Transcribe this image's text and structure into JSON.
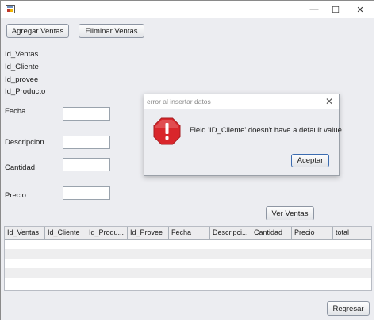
{
  "window": {
    "icons": {
      "app": "java-app-icon",
      "minimize": "minimize-icon",
      "maximize": "maximize-icon",
      "close": "close-icon"
    },
    "min_glyph": "—",
    "max_glyph": "☐",
    "close_glyph": "✕"
  },
  "toolbar": {
    "add_label": "Agregar Ventas",
    "delete_label": "Eliminar Ventas"
  },
  "info_labels": [
    "Id_Ventas",
    "Id_Cliente",
    "Id_provee",
    "Id_Producto"
  ],
  "form": {
    "fecha_label": "Fecha",
    "descripcion_label": "Descripcion",
    "cantidad_label": "Cantidad",
    "precio_label": "Precio",
    "fecha_value": "",
    "descripcion_value": "",
    "cantidad_value": "",
    "precio_value": ""
  },
  "ver_ventas_label": "Ver Ventas",
  "table": {
    "columns": [
      "Id_Ventas",
      "Id_Cliente",
      "Id_Produ...",
      "Id_Provee",
      "Fecha",
      "Descripci...",
      "Cantidad",
      "Precio",
      "total"
    ],
    "rows": []
  },
  "regresar_label": "Regresar",
  "dialog": {
    "title": "error al insertar datos",
    "close_glyph": "✕",
    "icon": "error-icon",
    "message": "Field 'ID_Cliente' doesn't have a default value",
    "accept_label": "Aceptar"
  },
  "colors": {
    "error_red": "#d9262b",
    "window_bg": "#ecedf1",
    "accent_border": "#3c6cb0"
  }
}
